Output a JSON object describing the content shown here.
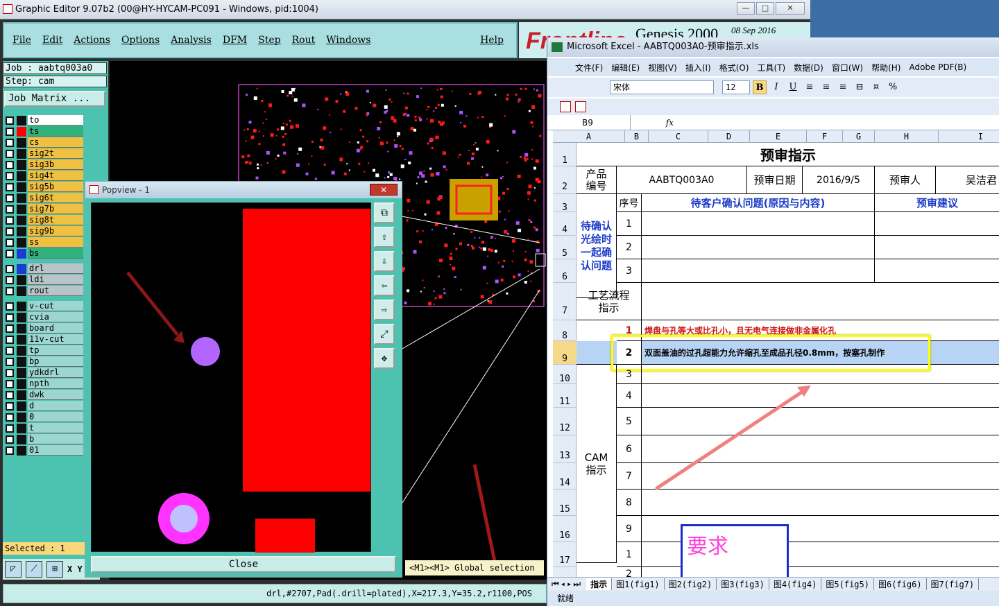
{
  "genesis": {
    "title": "Graphic Editor 9.07b2 (00@HY-HYCAM-PC091 - Windows, pid:1004)",
    "menu": [
      "File",
      "Edit",
      "Actions",
      "Options",
      "Analysis",
      "DFM",
      "Step",
      "Rout",
      "Windows"
    ],
    "help": "Help",
    "logo_text": "Genesis 2000",
    "logo_date": "08 Sep 2016",
    "job": "Job : aabtq003a0",
    "step": "Step: cam",
    "job_matrix": "Job Matrix ...",
    "layers": [
      "to",
      "ts",
      "cs",
      "sig2t",
      "sig3b",
      "sig4t",
      "sig5b",
      "sig6t",
      "sig7b",
      "sig8t",
      "sig9b",
      "ss",
      "bs",
      "drl",
      "ldi",
      "rout",
      "v-cut",
      "cvia",
      "board",
      "11v-cut",
      "tp",
      "bp",
      "ydkdrl",
      "npth",
      "dwk",
      "d",
      "0",
      "t",
      "b",
      "01"
    ],
    "selected": "Selected : 1",
    "message": "<M1><M1> Global selection",
    "status_line": "drl,#2707,Pad(.drill=plated),X=217.3,Y=35.2,r1100,POS",
    "x_label": "X Y"
  },
  "popview": {
    "title": "Popview - 1",
    "close_label": "Close"
  },
  "excel": {
    "title": "Microsoft Excel - AABTQ003A0-预审指示.xls",
    "menu": [
      "文件(F)",
      "编辑(E)",
      "视图(V)",
      "插入(I)",
      "格式(O)",
      "工具(T)",
      "数据(D)",
      "窗口(W)",
      "帮助(H)",
      "Adobe PDF(B)"
    ],
    "font_name": "宋体",
    "font_size": "12",
    "name_box": "B9",
    "fx": "fx",
    "columns": [
      "A",
      "B",
      "C",
      "D",
      "E",
      "F",
      "G",
      "H",
      "I"
    ],
    "rows": [
      "1",
      "2",
      "3",
      "4",
      "5",
      "6",
      "7",
      "8",
      "9",
      "10",
      "11",
      "12",
      "13",
      "14",
      "15",
      "16",
      "17"
    ],
    "sheet": {
      "title": "预审指示",
      "product_label": "产品编号",
      "product_value": "AABTQ003A0",
      "date_label": "预审日期",
      "date_value": "2016/9/5",
      "reviewer_label": "预审人",
      "reviewer_value": "吴洁君",
      "seq_label": "序号",
      "issue_header": "待客户确认问题(原因与内容)",
      "suggest_header": "预审建议",
      "confirm_label": "待确认光绘时一起确认问题",
      "process_label": "工艺流程指示",
      "cam_label": "CAM指示",
      "row8_num": "1",
      "row8_text": "焊盘与孔等大或比孔小，且无电气连接做非金属化孔",
      "row9_num": "2",
      "row9_text": "双面盖油的过孔超能力允许缩孔至成品孔径0.8mm，按塞孔制作",
      "seq_numbers": [
        "1",
        "2",
        "3",
        "3",
        "4",
        "5",
        "6",
        "7",
        "8",
        "9",
        "1",
        "2"
      ],
      "callout_text": "要求"
    },
    "tabs": [
      "指示",
      "图1(fig1)",
      "图2(fig2)",
      "图3(fig3)",
      "图4(fig4)",
      "图5(fig5)",
      "图6(fig6)",
      "图7(fig7)"
    ],
    "status": "就绪"
  },
  "colors": {
    "teal": "#4cc3b0",
    "pad_red": "#ff0000",
    "drill_violet": "#b266ff",
    "highlight_yellow": "#ffff00",
    "excel_select": "#b8d4f5"
  }
}
